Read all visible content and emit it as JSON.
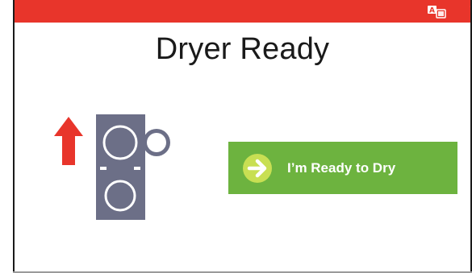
{
  "header": {
    "language_icon": "translate-icon",
    "help_label": "?",
    "bar_color": "#e8352b"
  },
  "main": {
    "title": "Dryer Ready",
    "illustration": {
      "icon": "dryer-stack-icon",
      "arrow": "up-arrow-icon",
      "arrow_color": "#e8352b",
      "machine_color": "#6c6f87"
    },
    "ready_button": {
      "label": "I’m Ready to Dry",
      "icon": "arrow-right-circle-icon",
      "color": "#6db33f"
    }
  }
}
